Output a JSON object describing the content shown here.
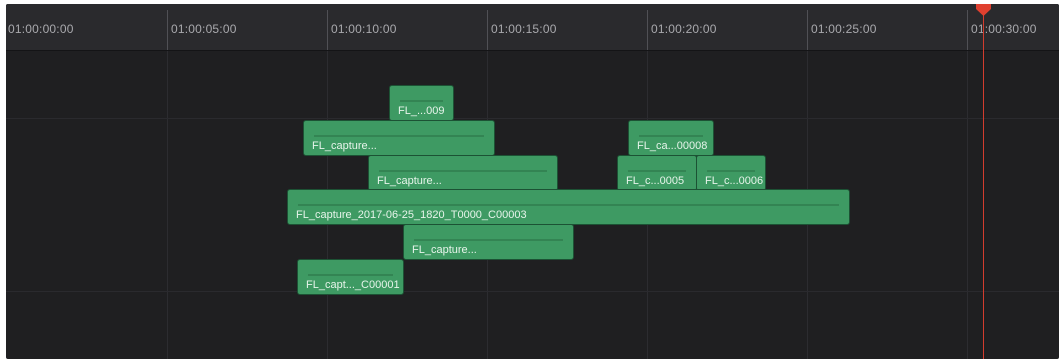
{
  "ruler": {
    "ticks": [
      "01:00:00:00",
      "01:00:05:00",
      "01:00:10:00",
      "01:00:15:00",
      "01:00:20:00",
      "01:00:25:00",
      "01:00:30:00"
    ]
  },
  "clips": [
    "FL_...009",
    "FL_capture...",
    "FL_ca...00008",
    "FL_capture...",
    "FL_c...0005",
    "FL_c...0006",
    "FL_capture_2017-06-25_1820_T0000_C00003",
    "FL_capture...",
    "FL_capt..._C00001"
  ],
  "colors": {
    "clip": "#3e9a63",
    "playhead": "#d23c2e",
    "background": "#1f1f21"
  }
}
